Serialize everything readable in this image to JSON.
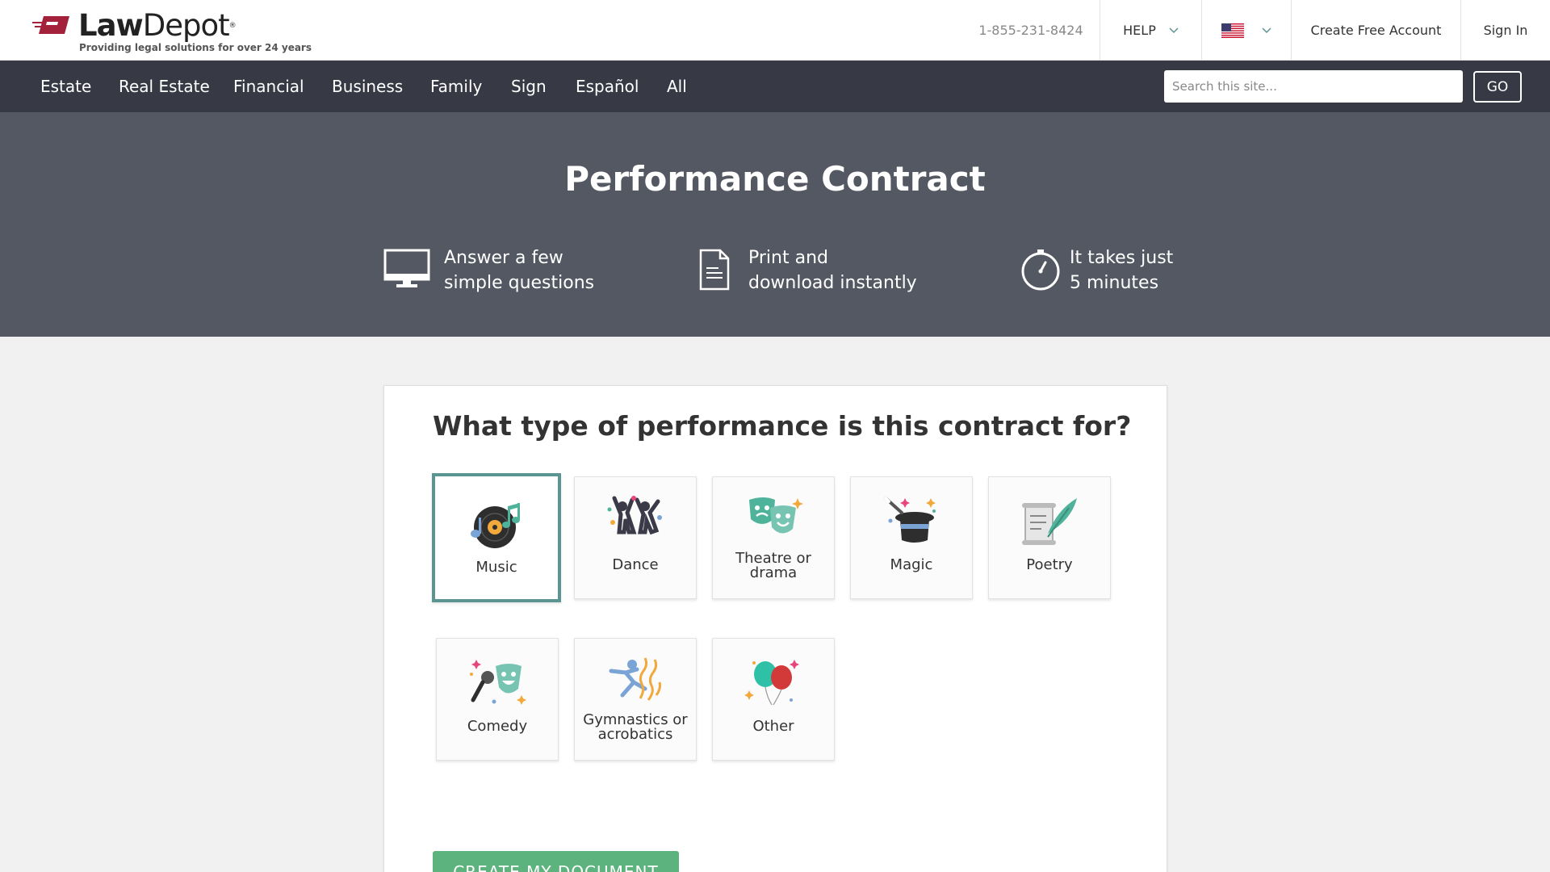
{
  "header": {
    "brand_name_bold": "Law",
    "brand_name_rest": "Depot",
    "brand_registered": "®",
    "tagline": "Providing legal solutions for over 24 years",
    "phone": "1-855-231-8424",
    "help_label": "HELP",
    "country_flag": "us-flag-icon",
    "create_account_label": "Create Free Account",
    "sign_in_label": "Sign In",
    "brand_color": "#a3213b"
  },
  "nav": {
    "items": [
      {
        "label": "Estate"
      },
      {
        "label": "Real Estate"
      },
      {
        "label": "Financial"
      },
      {
        "label": "Business"
      },
      {
        "label": "Family"
      },
      {
        "label": "Sign"
      },
      {
        "label": "Español"
      },
      {
        "label": "All"
      }
    ],
    "search_placeholder": "Search this site...",
    "go_label": "GO",
    "background_color": "#373a45"
  },
  "hero": {
    "title": "Performance Contract",
    "features": [
      {
        "icon": "monitor-icon",
        "line1": "Answer a few",
        "line2": "simple questions"
      },
      {
        "icon": "document-icon",
        "line1": "Print and",
        "line2": "download instantly"
      },
      {
        "icon": "stopwatch-icon",
        "line1": "It takes just",
        "line2": "5 minutes"
      }
    ],
    "background_color": "#545862"
  },
  "form": {
    "question": "What type of performance is this contract for?",
    "options": [
      {
        "label_line1": "Music",
        "label_line2": "",
        "icon": "music-icon",
        "selected": true
      },
      {
        "label_line1": "Dance",
        "label_line2": "",
        "icon": "dance-icon",
        "selected": false
      },
      {
        "label_line1": "Theatre or",
        "label_line2": "drama",
        "icon": "theatre-masks-icon",
        "selected": false
      },
      {
        "label_line1": "Magic",
        "label_line2": "",
        "icon": "magic-hat-icon",
        "selected": false
      },
      {
        "label_line1": "Poetry",
        "label_line2": "",
        "icon": "quill-scroll-icon",
        "selected": false
      },
      {
        "label_line1": "Comedy",
        "label_line2": "",
        "icon": "comedy-mic-icon",
        "selected": false
      },
      {
        "label_line1": "Gymnastics or",
        "label_line2": "acrobatics",
        "icon": "gymnast-icon",
        "selected": false
      },
      {
        "label_line1": "Other",
        "label_line2": "",
        "icon": "balloons-icon",
        "selected": false
      }
    ],
    "submit_label": "CREATE MY DOCUMENT",
    "selected_border_color": "#5b9592",
    "submit_color": "#5db37d"
  }
}
